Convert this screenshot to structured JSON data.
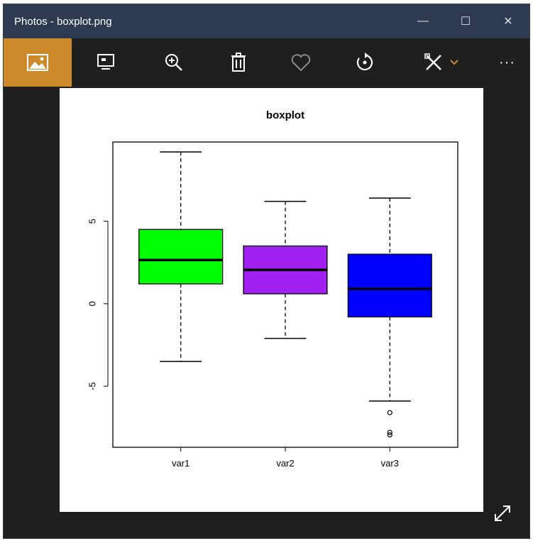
{
  "window": {
    "title": "Photos - boxplot.png",
    "controls": {
      "minimize": "—",
      "maximize": "☐",
      "close": "✕"
    }
  },
  "toolbar": {
    "buttons": [
      {
        "name": "image-icon",
        "label": ""
      },
      {
        "name": "slideshow-icon",
        "label": ""
      },
      {
        "name": "zoom-in-icon",
        "label": ""
      },
      {
        "name": "delete-icon",
        "label": ""
      },
      {
        "name": "favorite-icon",
        "label": ""
      },
      {
        "name": "rotate-icon",
        "label": ""
      },
      {
        "name": "edit-icon",
        "label": ""
      },
      {
        "name": "more-icon",
        "label": "···"
      }
    ],
    "accent_color": "#cc8a2a"
  },
  "chart_data": {
    "type": "boxplot",
    "title": "boxplot",
    "categories": [
      "var1",
      "var2",
      "var3"
    ],
    "yticks": [
      -5,
      0,
      5
    ],
    "ylim": [
      -8.7,
      9.8
    ],
    "series": [
      {
        "category": "var1",
        "color": "#00ff00",
        "whisker_low": -3.5,
        "q1": 1.2,
        "median": 2.65,
        "q3": 4.5,
        "whisker_high": 9.2,
        "outliers": []
      },
      {
        "category": "var2",
        "color": "#a020f0",
        "whisker_low": -2.1,
        "q1": 0.6,
        "median": 2.05,
        "q3": 3.5,
        "whisker_high": 6.2,
        "outliers": []
      },
      {
        "category": "var3",
        "color": "#0000ff",
        "whisker_low": -5.9,
        "q1": -0.8,
        "median": 0.9,
        "q3": 3.0,
        "whisker_high": 6.4,
        "outliers": [
          -6.6,
          -7.8,
          -7.95
        ]
      }
    ]
  }
}
